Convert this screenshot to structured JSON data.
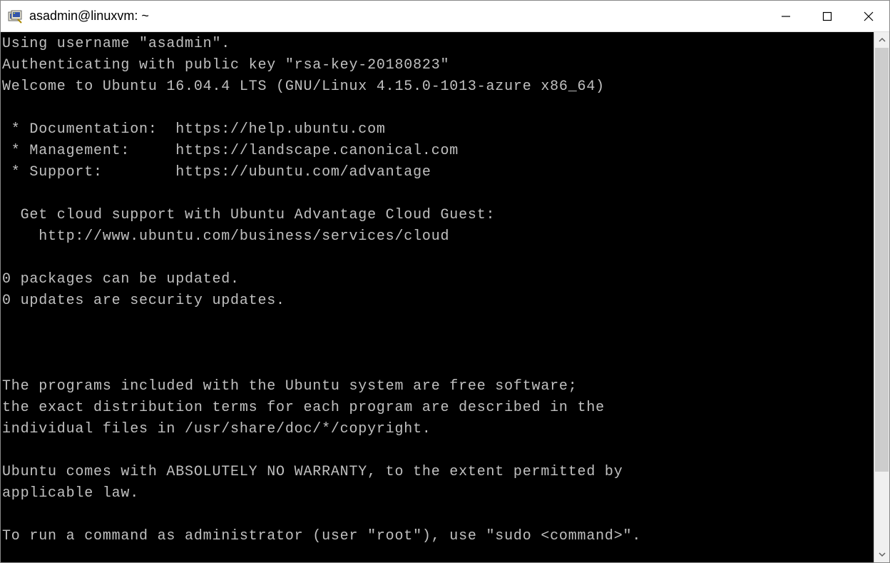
{
  "window": {
    "title": "asadmin@linuxvm: ~"
  },
  "terminal": {
    "lines": [
      "Using username \"asadmin\".",
      "Authenticating with public key \"rsa-key-20180823\"",
      "Welcome to Ubuntu 16.04.4 LTS (GNU/Linux 4.15.0-1013-azure x86_64)",
      "",
      " * Documentation:  https://help.ubuntu.com",
      " * Management:     https://landscape.canonical.com",
      " * Support:        https://ubuntu.com/advantage",
      "",
      "  Get cloud support with Ubuntu Advantage Cloud Guest:",
      "    http://www.ubuntu.com/business/services/cloud",
      "",
      "0 packages can be updated.",
      "0 updates are security updates.",
      "",
      "",
      "",
      "The programs included with the Ubuntu system are free software;",
      "the exact distribution terms for each program are described in the",
      "individual files in /usr/share/doc/*/copyright.",
      "",
      "Ubuntu comes with ABSOLUTELY NO WARRANTY, to the extent permitted by",
      "applicable law.",
      "",
      "To run a command as administrator (user \"root\"), use \"sudo <command>\"."
    ]
  }
}
